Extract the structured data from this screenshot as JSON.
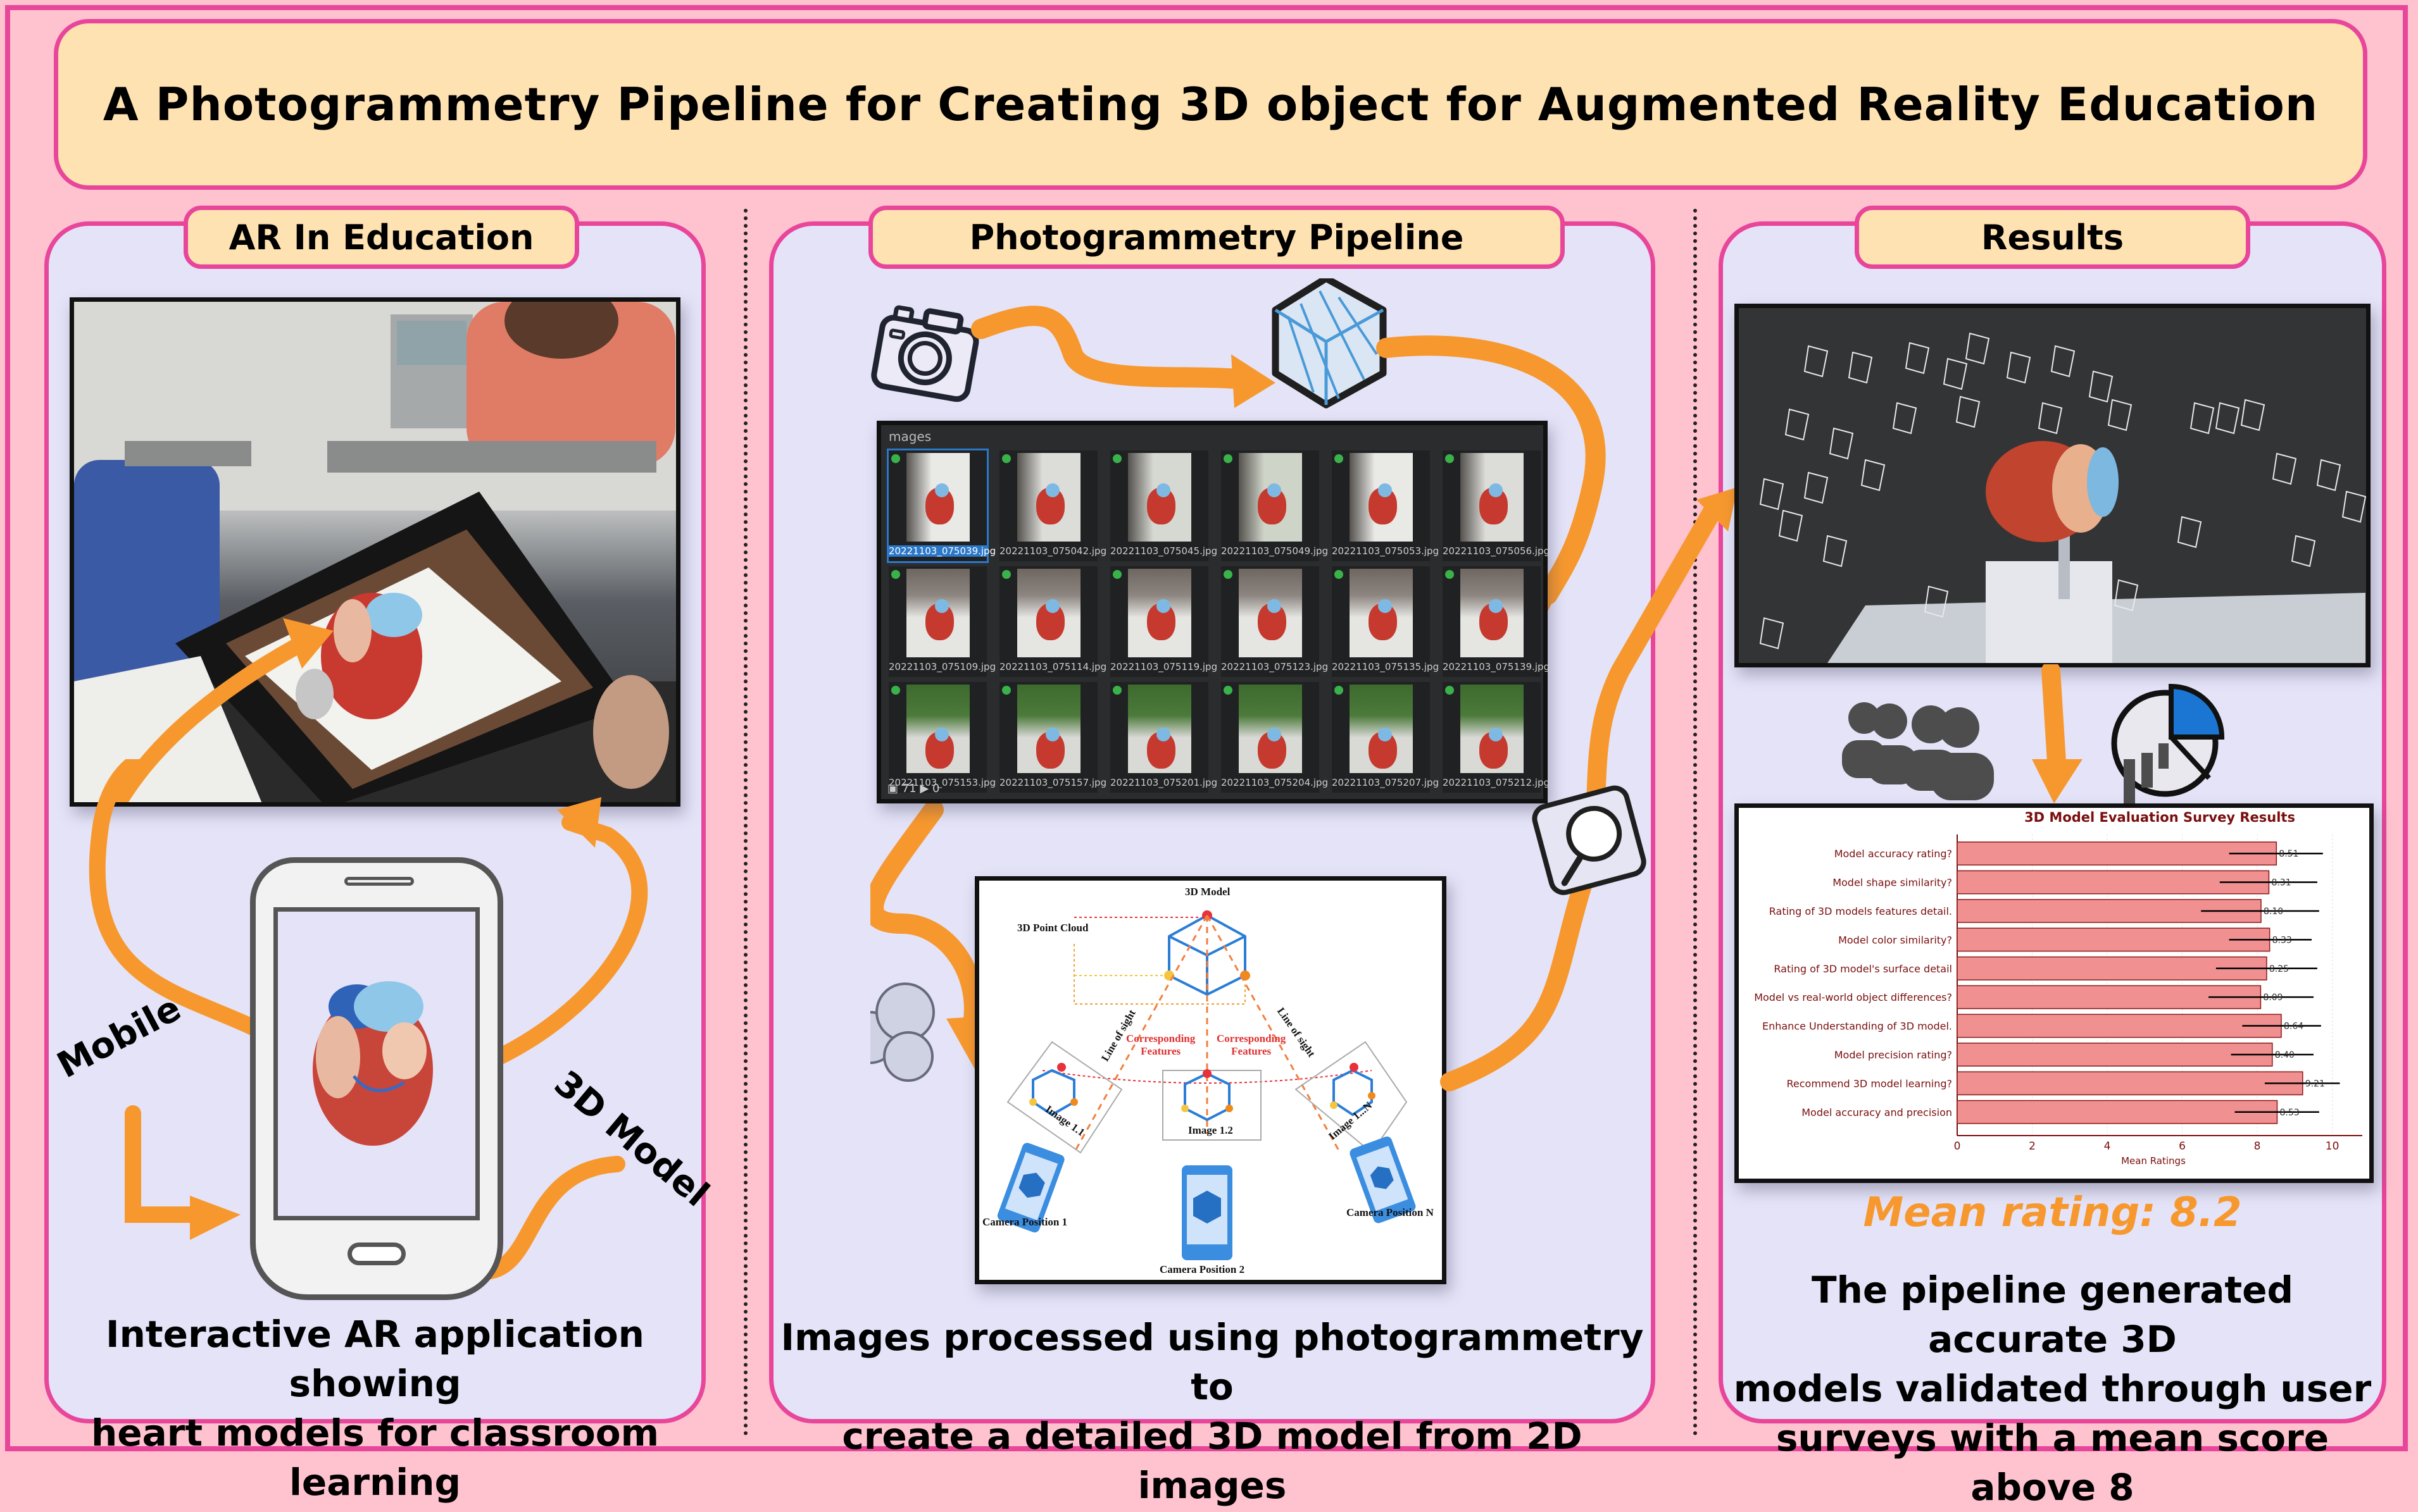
{
  "title": "A Photogrammetry Pipeline for Creating 3D object for Augmented Reality Education",
  "colors": {
    "background": "#FFC2CF",
    "border": "#E8469A",
    "title_fill": "#FFE2B2",
    "panel_fill": "#E4E3F8",
    "arrow": "#F7982F",
    "bar_fill": "#F09090",
    "bar_edge": "#8B1A1A",
    "chart_text": "#7A0E0E"
  },
  "panels": {
    "left": {
      "header": "AR In Education",
      "label_mobile": "Mobile",
      "label_3d_model": "3D Model",
      "caption_line1": "Interactive AR application showing",
      "caption_line2": "heart models for classroom learning"
    },
    "middle": {
      "header": "Photogrammetry Pipeline",
      "gallery": {
        "title": "mages",
        "images": [
          "20221103_075039.jpg",
          "20221103_075042.jpg",
          "20221103_075045.jpg",
          "20221103_075049.jpg",
          "20221103_075053.jpg",
          "20221103_075056.jpg",
          "20221103_075109.jpg",
          "20221103_075114.jpg",
          "20221103_075119.jpg",
          "20221103_075123.jpg",
          "20221103_075135.jpg",
          "20221103_075139.jpg",
          "20221103_075153.jpg",
          "20221103_075157.jpg",
          "20221103_075201.jpg",
          "20221103_075204.jpg",
          "20221103_075207.jpg",
          "20221103_075212.jpg"
        ],
        "selected_index": 0,
        "image_count": "71",
        "video_count": "0"
      },
      "diagram": {
        "title": "3D Model",
        "point_cloud_label": "3D Point Cloud",
        "line_of_sight": "Line of sight",
        "corresponding_features_1": "Corresponding",
        "corresponding_features_2": "Features",
        "image_1": "Image 1.1",
        "image_2": "Image 1.2",
        "image_n": "Image 1...N",
        "camera_1": "Camera Position 1",
        "camera_2": "Camera Position 2",
        "camera_n": "Camera Position N"
      },
      "caption_line1": "Images processed using photogrammetry to",
      "caption_line2": "create a detailed 3D model from 2D images"
    },
    "right": {
      "header": "Results",
      "mean_rating": "Mean rating: 8.2",
      "caption_line1": "The pipeline generated accurate 3D",
      "caption_line2": "models validated through user",
      "caption_line3": "surveys with a mean score above 8"
    }
  },
  "chart_data": {
    "type": "bar",
    "orientation": "horizontal",
    "title": "3D Model Evaluation Survey Results",
    "xlabel": "Mean Ratings",
    "ylabel": "",
    "xlim": [
      0,
      10.8
    ],
    "xticks": [
      0,
      2,
      4,
      6,
      8,
      10
    ],
    "grid": true,
    "categories": [
      "Model accuracy rating?",
      "Model shape similarity?",
      "Rating of 3D models features detail.",
      "Model color similarity?",
      "Rating of 3D model's surface detail",
      "Model vs real-world object differences?",
      "Enhance Understanding of 3D model.",
      "Model precision rating?",
      "Recommend 3D model learning?",
      "Model accuracy and precision"
    ],
    "values": [
      8.51,
      8.31,
      8.1,
      8.33,
      8.25,
      8.09,
      8.64,
      8.4,
      9.21,
      8.53
    ],
    "value_labels": [
      "8.51",
      "8.31",
      "8.10",
      "8.33",
      "8.25",
      "8.09",
      "8.64",
      "8.40",
      "9.21",
      "8.53"
    ],
    "error_low": [
      7.25,
      7.0,
      6.5,
      7.25,
      6.9,
      6.7,
      7.6,
      7.3,
      8.2,
      7.4
    ],
    "error_high": [
      9.75,
      9.6,
      9.65,
      9.45,
      9.6,
      9.5,
      9.7,
      9.5,
      10.2,
      9.65
    ]
  }
}
